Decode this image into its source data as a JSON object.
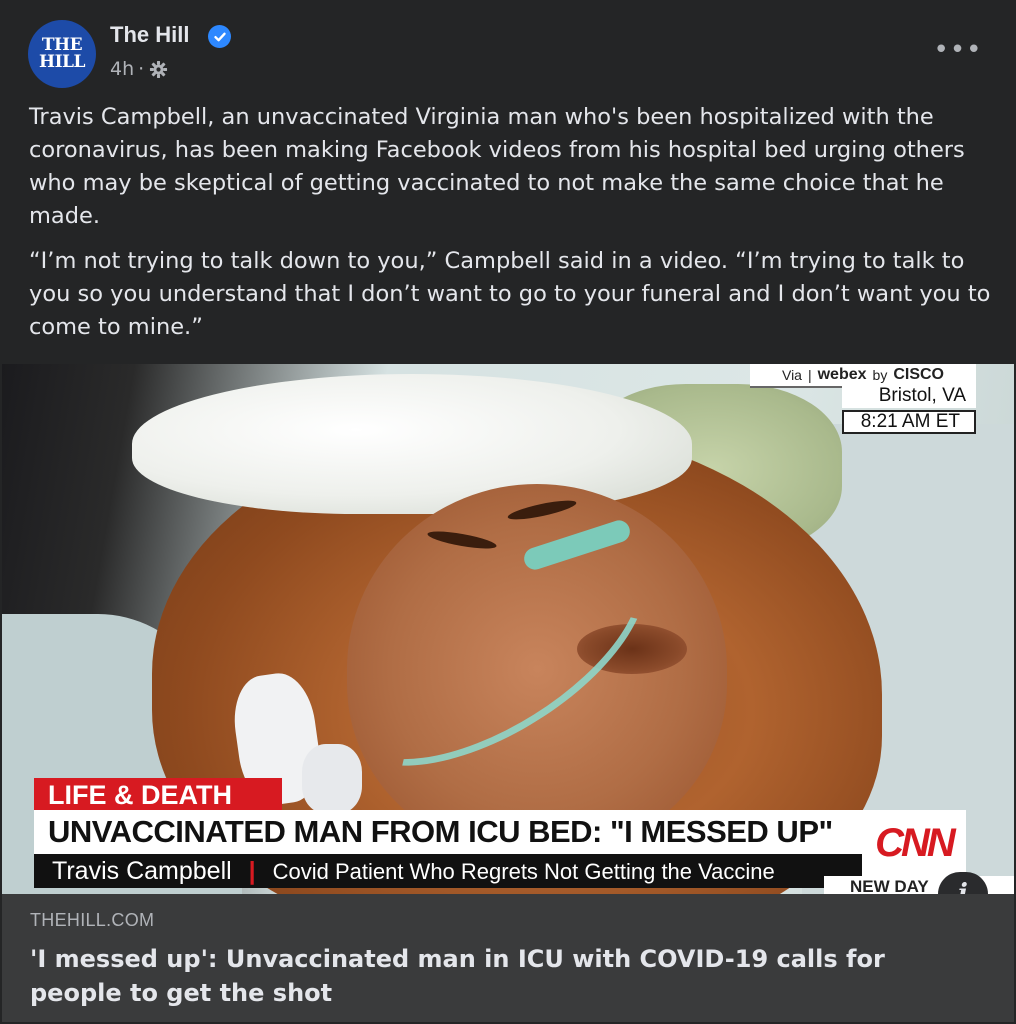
{
  "post": {
    "page_name": "The Hill",
    "avatar_line1": "THE",
    "avatar_line2": "HILL",
    "timestamp": "4h",
    "separator": "·",
    "verified_icon": "verified-badge-icon",
    "audience_icon": "gear-icon",
    "more_label": "•••",
    "paragraphs": [
      "Travis Campbell, an unvaccinated Virginia man who's been hospitalized with the coronavirus, has been making Facebook videos from his hospital bed urging others who may be skeptical of getting vaccinated to not make the same choice that he made.",
      "“I’m not trying to talk down to you,” Campbell said in a video. “I’m trying to talk to you so you understand that I don’t want to go to your funeral and I don’t want you to come to mine.”"
    ]
  },
  "media": {
    "webex_via": "Via",
    "webex_sep": "|",
    "webex_brand": "webex",
    "webex_by": "by",
    "webex_cisco": "CISCO",
    "location": "Bristol, VA",
    "time": "8:21 AM ET",
    "tag": "LIFE & DEATH",
    "headline": "UNVACCINATED MAN FROM ICU BED: \"I MESSED UP\"",
    "name": "Travis Campbell",
    "name_sep": "|",
    "subtitle": "Covid Patient Who Regrets Not Getting the Vaccine",
    "network_logo": "CNN",
    "show": "NEW DAY",
    "info_label": "i"
  },
  "link": {
    "domain": "THEHILL.COM",
    "title": "'I messed up': Unvaccinated man in ICU with COVID-19 calls for people to get the shot"
  },
  "colors": {
    "background": "#242526",
    "link_bg": "#3a3b3c",
    "verified": "#2d88ff",
    "cnn_red": "#d71a21",
    "avatar": "#1d4ba8"
  }
}
